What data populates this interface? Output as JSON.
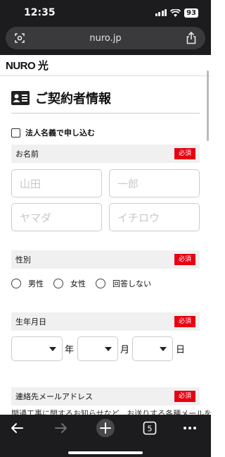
{
  "status": {
    "time": "12:35",
    "battery": "93"
  },
  "browser": {
    "url": "nuro.jp",
    "tab_count": "5"
  },
  "site": {
    "logo": "NURO 光"
  },
  "form": {
    "title": "ご契約者情報",
    "corporate_checkbox_label": "法人名義で申し込む",
    "required_badge": "必須",
    "name": {
      "label": "お名前",
      "last_name_placeholder": "山田",
      "first_name_placeholder": "一郎",
      "last_kana_placeholder": "ヤマダ",
      "first_kana_placeholder": "イチロウ"
    },
    "gender": {
      "label": "性別",
      "options": [
        "男性",
        "女性",
        "回答しない"
      ]
    },
    "birthdate": {
      "label": "生年月日",
      "year_unit": "年",
      "month_unit": "月",
      "day_unit": "日"
    },
    "email": {
      "label": "連絡先メールアドレス",
      "description_partial": "開通工事に関するお知らせなど、お送りする各種メールを"
    }
  },
  "icons": {
    "url_left": "page-settings-icon",
    "url_right": "share-icon",
    "back": "back-arrow-icon",
    "forward": "forward-arrow-icon",
    "new_tab": "plus-icon",
    "tabs": "tabs-icon",
    "more": "more-icon",
    "title": "contact-card-icon"
  }
}
